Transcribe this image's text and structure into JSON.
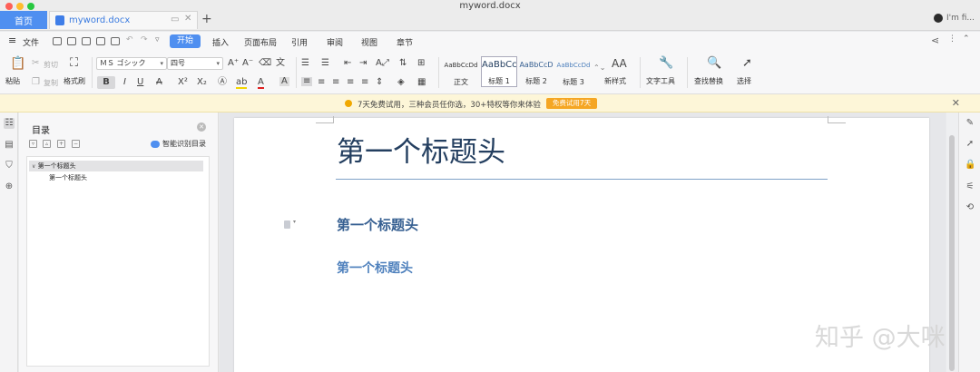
{
  "window": {
    "title": "myword.docx"
  },
  "tabs": {
    "home": "首页",
    "doc": "myword.docx",
    "user": "I'm fi..."
  },
  "menu": {
    "file": "文件",
    "start": "开始",
    "insert": "插入",
    "layout": "页面布局",
    "reference": "引用",
    "review": "审阅",
    "view": "视图",
    "chapter": "章节"
  },
  "ribbon": {
    "paste": "粘贴",
    "cut": "剪切",
    "copy": "复制",
    "format_painter": "格式刷",
    "font_name": "ＭＳ ゴシック",
    "font_size": "四号",
    "styles": [
      {
        "preview": "AaBbCcDd",
        "name": "正文"
      },
      {
        "preview": "AaBbCcI",
        "name": "标题 1"
      },
      {
        "preview": "AaBbCcD",
        "name": "标题 2"
      },
      {
        "preview": "AaBbCcDd",
        "name": "标题 3"
      }
    ],
    "new_style": "新样式",
    "text_tools": "文字工具",
    "find_replace": "查找替换",
    "select": "选择"
  },
  "trial": {
    "message": "7天免费试用，三种会员任你选，30+特权等你来体验",
    "button": "免费试用7天"
  },
  "toc": {
    "title": "目录",
    "smart": "智能识别目录",
    "items": [
      "第一个标题头",
      "第一个标题头"
    ]
  },
  "document": {
    "title": "第一个标题头",
    "heading1": "第一个标题头",
    "heading2": "第一个标题头"
  },
  "watermark": "知乎 @大咪",
  "colors": {
    "accent": "#4f8ff0",
    "title_text": "#243f60",
    "heading1_text": "#365f91",
    "heading2_text": "#4f81bd",
    "trial_bg": "#fdf6d8",
    "trial_button": "#f5a623"
  }
}
